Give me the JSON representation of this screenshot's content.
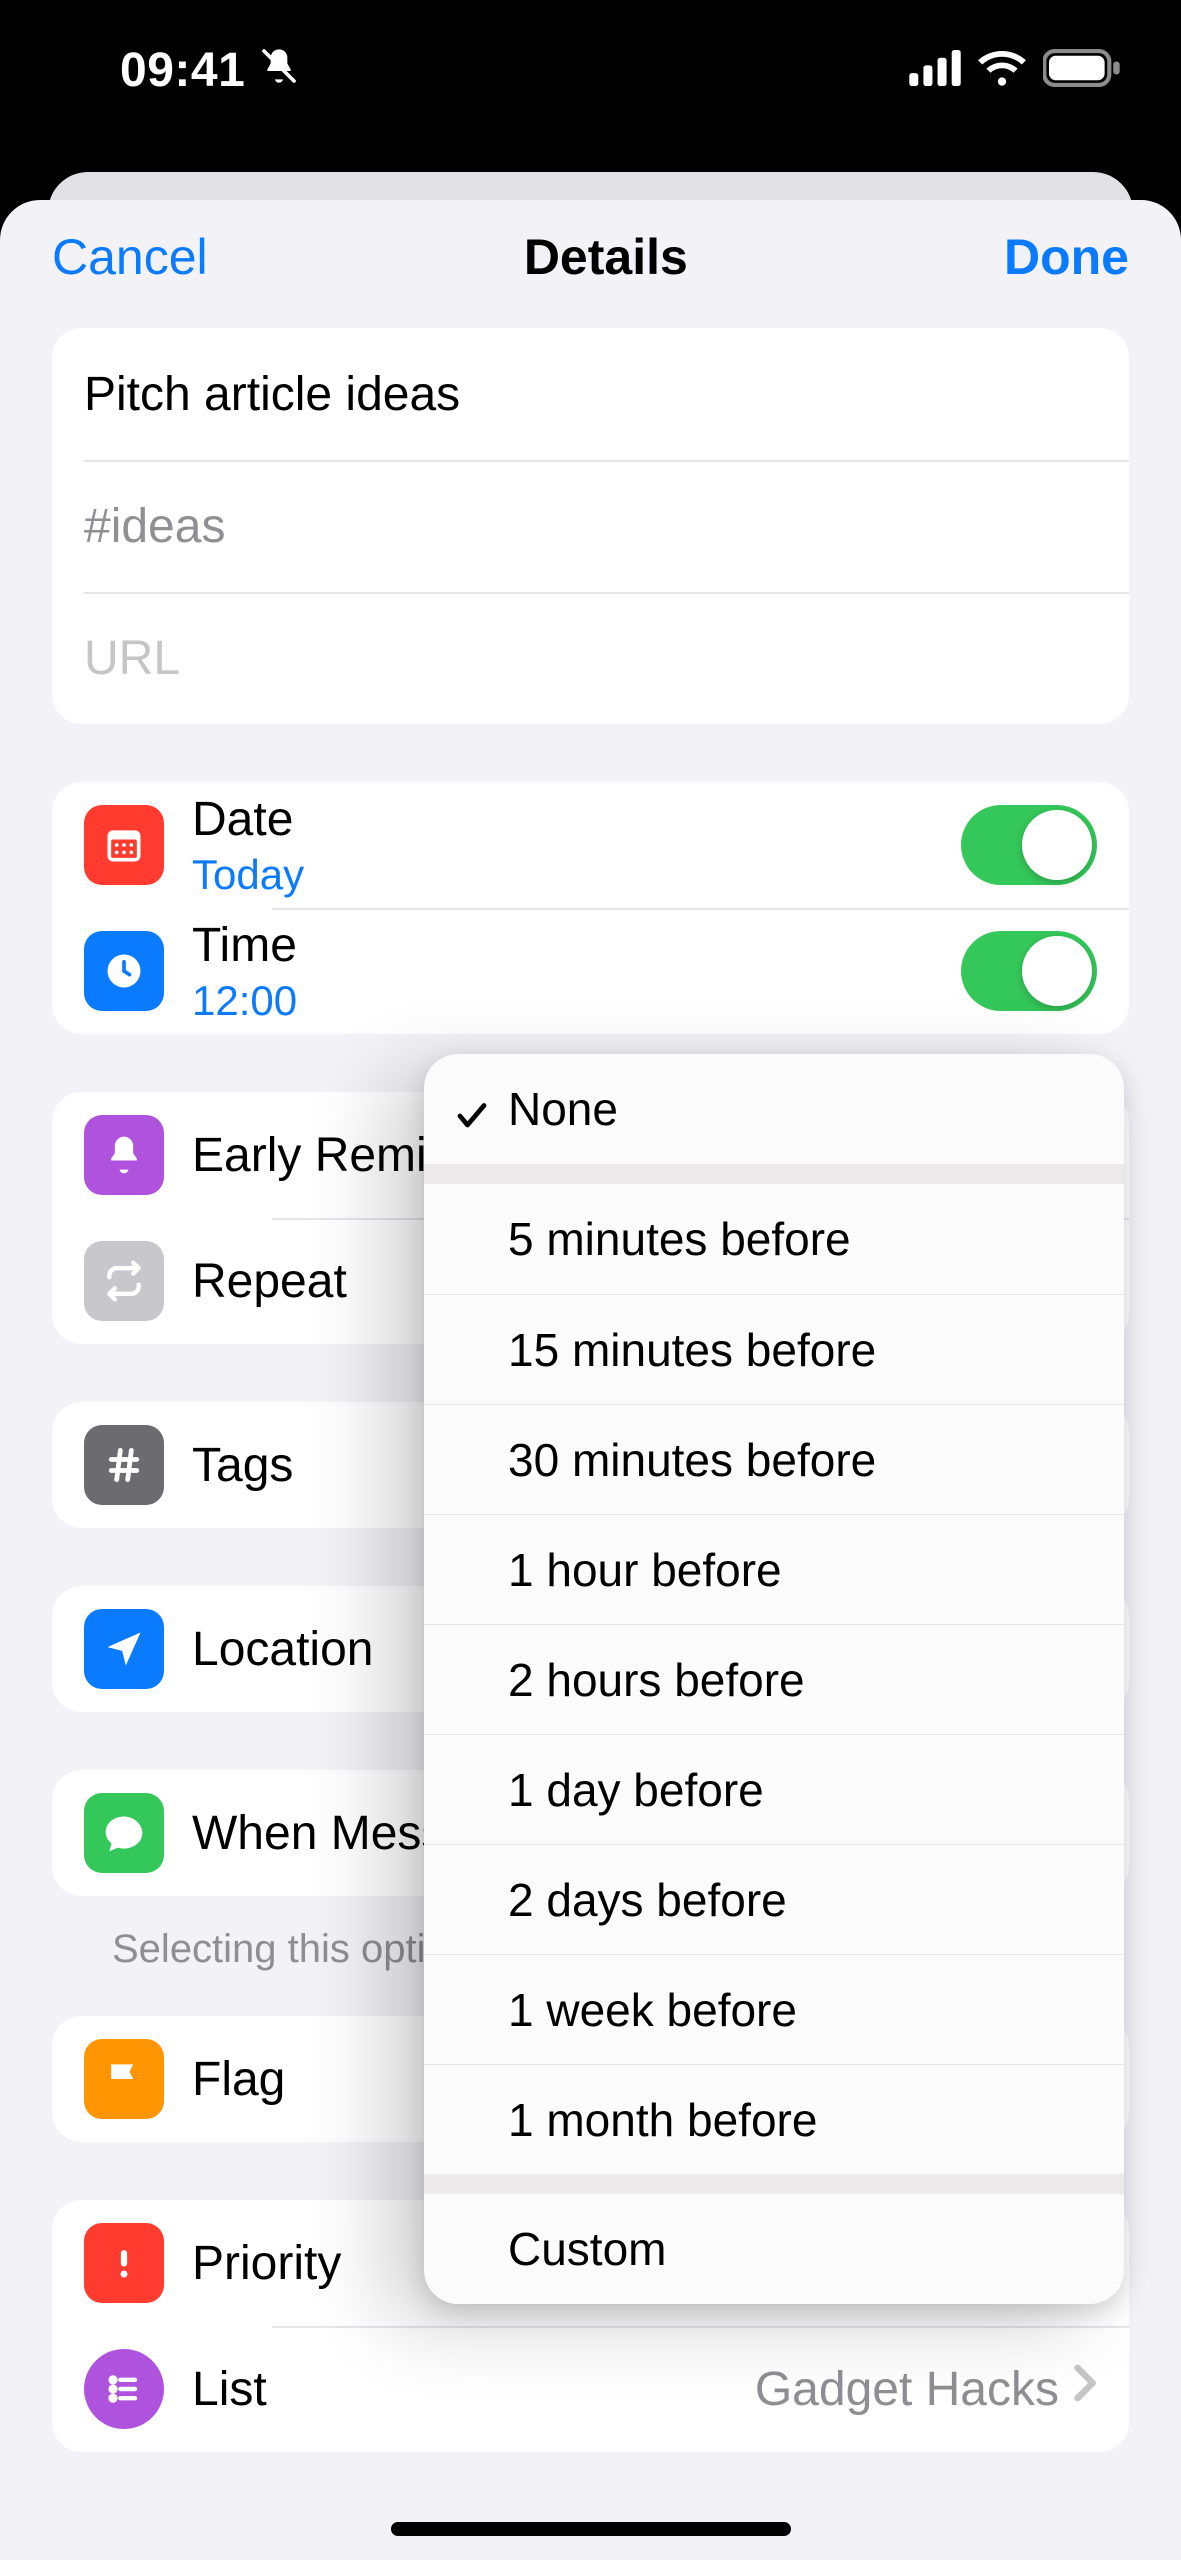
{
  "status": {
    "time": "09:41"
  },
  "nav": {
    "cancel": "Cancel",
    "title": "Details",
    "done": "Done"
  },
  "fields": {
    "title": "Pitch article ideas",
    "notes": "#ideas",
    "url_placeholder": "URL"
  },
  "datetime": {
    "date_label": "Date",
    "date_value": "Today",
    "date_on": true,
    "time_label": "Time",
    "time_value": "12:00",
    "time_on": true
  },
  "reminder": {
    "early_label": "Early Reminder",
    "early_value": "None",
    "repeat_label": "Repeat"
  },
  "tags": {
    "label": "Tags"
  },
  "location": {
    "label": "Location"
  },
  "messaging": {
    "label": "When Mess"
  },
  "messaging_note": "Selecting this option chatting with a perso",
  "flag": {
    "label": "Flag"
  },
  "priority": {
    "label": "Priority"
  },
  "list": {
    "label": "List",
    "value": "Gadget Hacks"
  },
  "popup": {
    "selected": "None",
    "options_group1": [
      "None"
    ],
    "options_group2": [
      "5 minutes before",
      "15 minutes before",
      "30 minutes before",
      "1 hour before",
      "2 hours before",
      "1 day before",
      "2 days before",
      "1 week before",
      "1 month before"
    ],
    "options_group3": [
      "Custom"
    ]
  }
}
